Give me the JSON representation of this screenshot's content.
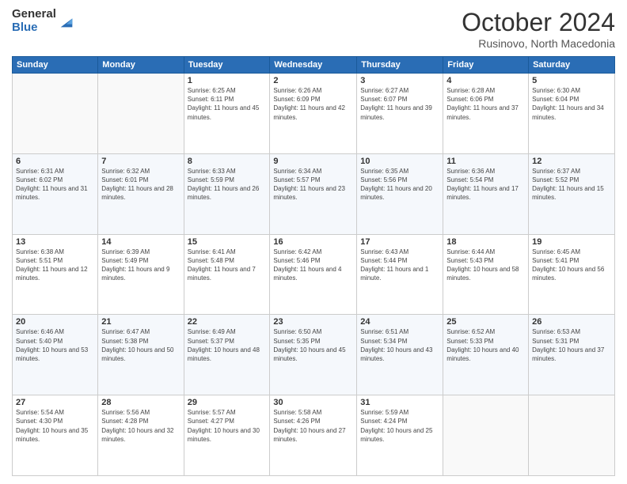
{
  "logo": {
    "general": "General",
    "blue": "Blue"
  },
  "header": {
    "title": "October 2024",
    "subtitle": "Rusinovo, North Macedonia"
  },
  "days_of_week": [
    "Sunday",
    "Monday",
    "Tuesday",
    "Wednesday",
    "Thursday",
    "Friday",
    "Saturday"
  ],
  "weeks": [
    [
      {
        "day": "",
        "sunrise": "",
        "sunset": "",
        "daylight": ""
      },
      {
        "day": "",
        "sunrise": "",
        "sunset": "",
        "daylight": ""
      },
      {
        "day": "1",
        "sunrise": "Sunrise: 6:25 AM",
        "sunset": "Sunset: 6:11 PM",
        "daylight": "Daylight: 11 hours and 45 minutes."
      },
      {
        "day": "2",
        "sunrise": "Sunrise: 6:26 AM",
        "sunset": "Sunset: 6:09 PM",
        "daylight": "Daylight: 11 hours and 42 minutes."
      },
      {
        "day": "3",
        "sunrise": "Sunrise: 6:27 AM",
        "sunset": "Sunset: 6:07 PM",
        "daylight": "Daylight: 11 hours and 39 minutes."
      },
      {
        "day": "4",
        "sunrise": "Sunrise: 6:28 AM",
        "sunset": "Sunset: 6:06 PM",
        "daylight": "Daylight: 11 hours and 37 minutes."
      },
      {
        "day": "5",
        "sunrise": "Sunrise: 6:30 AM",
        "sunset": "Sunset: 6:04 PM",
        "daylight": "Daylight: 11 hours and 34 minutes."
      }
    ],
    [
      {
        "day": "6",
        "sunrise": "Sunrise: 6:31 AM",
        "sunset": "Sunset: 6:02 PM",
        "daylight": "Daylight: 11 hours and 31 minutes."
      },
      {
        "day": "7",
        "sunrise": "Sunrise: 6:32 AM",
        "sunset": "Sunset: 6:01 PM",
        "daylight": "Daylight: 11 hours and 28 minutes."
      },
      {
        "day": "8",
        "sunrise": "Sunrise: 6:33 AM",
        "sunset": "Sunset: 5:59 PM",
        "daylight": "Daylight: 11 hours and 26 minutes."
      },
      {
        "day": "9",
        "sunrise": "Sunrise: 6:34 AM",
        "sunset": "Sunset: 5:57 PM",
        "daylight": "Daylight: 11 hours and 23 minutes."
      },
      {
        "day": "10",
        "sunrise": "Sunrise: 6:35 AM",
        "sunset": "Sunset: 5:56 PM",
        "daylight": "Daylight: 11 hours and 20 minutes."
      },
      {
        "day": "11",
        "sunrise": "Sunrise: 6:36 AM",
        "sunset": "Sunset: 5:54 PM",
        "daylight": "Daylight: 11 hours and 17 minutes."
      },
      {
        "day": "12",
        "sunrise": "Sunrise: 6:37 AM",
        "sunset": "Sunset: 5:52 PM",
        "daylight": "Daylight: 11 hours and 15 minutes."
      }
    ],
    [
      {
        "day": "13",
        "sunrise": "Sunrise: 6:38 AM",
        "sunset": "Sunset: 5:51 PM",
        "daylight": "Daylight: 11 hours and 12 minutes."
      },
      {
        "day": "14",
        "sunrise": "Sunrise: 6:39 AM",
        "sunset": "Sunset: 5:49 PM",
        "daylight": "Daylight: 11 hours and 9 minutes."
      },
      {
        "day": "15",
        "sunrise": "Sunrise: 6:41 AM",
        "sunset": "Sunset: 5:48 PM",
        "daylight": "Daylight: 11 hours and 7 minutes."
      },
      {
        "day": "16",
        "sunrise": "Sunrise: 6:42 AM",
        "sunset": "Sunset: 5:46 PM",
        "daylight": "Daylight: 11 hours and 4 minutes."
      },
      {
        "day": "17",
        "sunrise": "Sunrise: 6:43 AM",
        "sunset": "Sunset: 5:44 PM",
        "daylight": "Daylight: 11 hours and 1 minute."
      },
      {
        "day": "18",
        "sunrise": "Sunrise: 6:44 AM",
        "sunset": "Sunset: 5:43 PM",
        "daylight": "Daylight: 10 hours and 58 minutes."
      },
      {
        "day": "19",
        "sunrise": "Sunrise: 6:45 AM",
        "sunset": "Sunset: 5:41 PM",
        "daylight": "Daylight: 10 hours and 56 minutes."
      }
    ],
    [
      {
        "day": "20",
        "sunrise": "Sunrise: 6:46 AM",
        "sunset": "Sunset: 5:40 PM",
        "daylight": "Daylight: 10 hours and 53 minutes."
      },
      {
        "day": "21",
        "sunrise": "Sunrise: 6:47 AM",
        "sunset": "Sunset: 5:38 PM",
        "daylight": "Daylight: 10 hours and 50 minutes."
      },
      {
        "day": "22",
        "sunrise": "Sunrise: 6:49 AM",
        "sunset": "Sunset: 5:37 PM",
        "daylight": "Daylight: 10 hours and 48 minutes."
      },
      {
        "day": "23",
        "sunrise": "Sunrise: 6:50 AM",
        "sunset": "Sunset: 5:35 PM",
        "daylight": "Daylight: 10 hours and 45 minutes."
      },
      {
        "day": "24",
        "sunrise": "Sunrise: 6:51 AM",
        "sunset": "Sunset: 5:34 PM",
        "daylight": "Daylight: 10 hours and 43 minutes."
      },
      {
        "day": "25",
        "sunrise": "Sunrise: 6:52 AM",
        "sunset": "Sunset: 5:33 PM",
        "daylight": "Daylight: 10 hours and 40 minutes."
      },
      {
        "day": "26",
        "sunrise": "Sunrise: 6:53 AM",
        "sunset": "Sunset: 5:31 PM",
        "daylight": "Daylight: 10 hours and 37 minutes."
      }
    ],
    [
      {
        "day": "27",
        "sunrise": "Sunrise: 5:54 AM",
        "sunset": "Sunset: 4:30 PM",
        "daylight": "Daylight: 10 hours and 35 minutes."
      },
      {
        "day": "28",
        "sunrise": "Sunrise: 5:56 AM",
        "sunset": "Sunset: 4:28 PM",
        "daylight": "Daylight: 10 hours and 32 minutes."
      },
      {
        "day": "29",
        "sunrise": "Sunrise: 5:57 AM",
        "sunset": "Sunset: 4:27 PM",
        "daylight": "Daylight: 10 hours and 30 minutes."
      },
      {
        "day": "30",
        "sunrise": "Sunrise: 5:58 AM",
        "sunset": "Sunset: 4:26 PM",
        "daylight": "Daylight: 10 hours and 27 minutes."
      },
      {
        "day": "31",
        "sunrise": "Sunrise: 5:59 AM",
        "sunset": "Sunset: 4:24 PM",
        "daylight": "Daylight: 10 hours and 25 minutes."
      },
      {
        "day": "",
        "sunrise": "",
        "sunset": "",
        "daylight": ""
      },
      {
        "day": "",
        "sunrise": "",
        "sunset": "",
        "daylight": ""
      }
    ]
  ]
}
